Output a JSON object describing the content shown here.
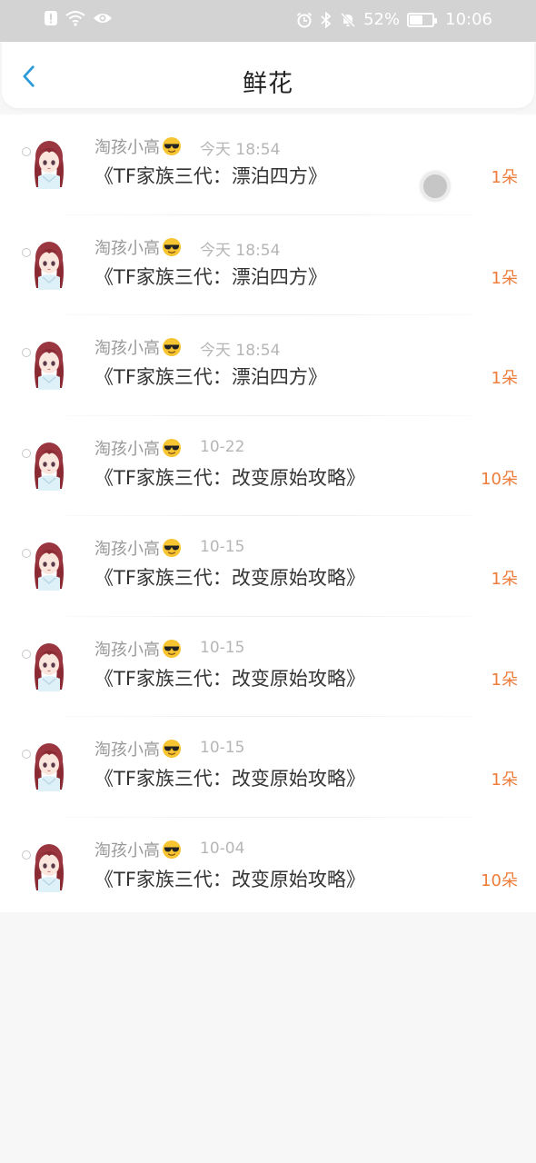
{
  "status_bar": {
    "battery": "52%",
    "time": "10:06",
    "left_icons": [
      "alert-icon",
      "wifi-icon",
      "eye-icon"
    ],
    "right_icons": [
      "alarm-icon",
      "bluetooth-icon",
      "mute-icon",
      "battery-icon"
    ]
  },
  "nav": {
    "title": "鲜花",
    "back_icon": "chevron-left-icon"
  },
  "colors": {
    "accent": "#2a9bd8",
    "count": "#ee7c3a",
    "status_bg": "#d3d3d3"
  },
  "records": [
    {
      "username": "淘孩小高",
      "time": "今天 18:54",
      "book": "《TF家族三代：漂泊四方》",
      "count": "1朵"
    },
    {
      "username": "淘孩小高",
      "time": "今天 18:54",
      "book": "《TF家族三代：漂泊四方》",
      "count": "1朵"
    },
    {
      "username": "淘孩小高",
      "time": "今天 18:54",
      "book": "《TF家族三代：漂泊四方》",
      "count": "1朵"
    },
    {
      "username": "淘孩小高",
      "time": "10-22",
      "book": "《TF家族三代：改变原始攻略》",
      "count": "10朵"
    },
    {
      "username": "淘孩小高",
      "time": "10-15",
      "book": "《TF家族三代：改变原始攻略》",
      "count": "1朵"
    },
    {
      "username": "淘孩小高",
      "time": "10-15",
      "book": "《TF家族三代：改变原始攻略》",
      "count": "1朵"
    },
    {
      "username": "淘孩小高",
      "time": "10-15",
      "book": "《TF家族三代：改变原始攻略》",
      "count": "1朵"
    },
    {
      "username": "淘孩小高",
      "time": "10-04",
      "book": "《TF家族三代：改变原始攻略》",
      "count": "10朵"
    }
  ]
}
